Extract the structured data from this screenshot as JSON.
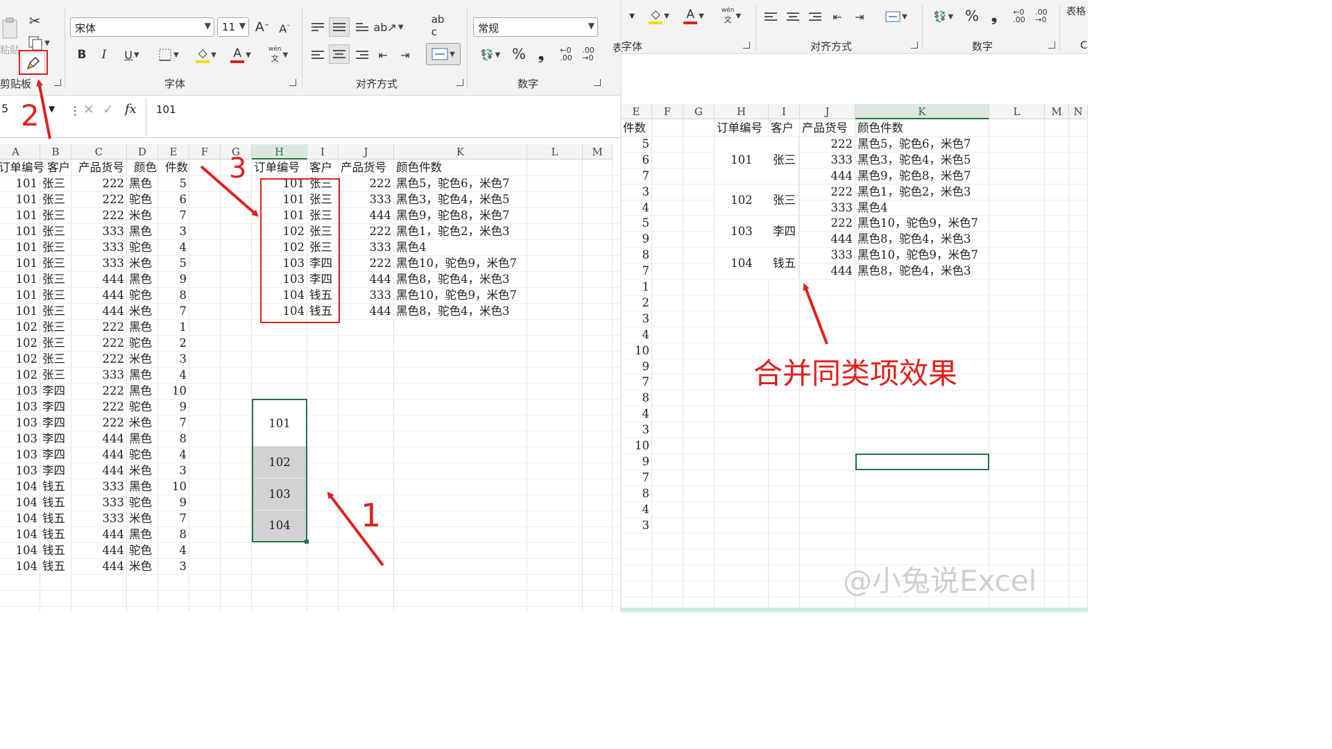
{
  "ribbon": {
    "clipboard_label": "剪贴板",
    "paste_label": "粘贴",
    "font_group_label": "字体",
    "align_group_label": "对齐方式",
    "number_group_label": "数字",
    "font_name": "宋体",
    "font_size": "11",
    "number_format": "常规",
    "bold": "B",
    "italic": "I",
    "underline": "U",
    "percent": "%",
    "comma": "❟",
    "wen": "wén",
    "grow": "A",
    "shrink": "A"
  },
  "ribbon_right": {
    "font_group_partial": "字体",
    "biao_partial": "表",
    "align_group_label": "对齐方式",
    "number_group_label": "数字",
    "table_partial": "表格"
  },
  "formula_bar": {
    "name_box": "5",
    "fx": "fx",
    "value": "101"
  },
  "left_sheet": {
    "columns": [
      "A",
      "B",
      "C",
      "D",
      "E",
      "F",
      "G",
      "H",
      "I",
      "J",
      "K",
      "L",
      "M"
    ],
    "selected_column": "H",
    "headers": [
      "订单编号",
      "客户",
      "产品货号",
      "颜色",
      "件数"
    ],
    "rows": [
      [
        "101",
        "张三",
        "222",
        "黑色",
        "5"
      ],
      [
        "101",
        "张三",
        "222",
        "驼色",
        "6"
      ],
      [
        "101",
        "张三",
        "222",
        "米色",
        "7"
      ],
      [
        "101",
        "张三",
        "333",
        "黑色",
        "3"
      ],
      [
        "101",
        "张三",
        "333",
        "驼色",
        "4"
      ],
      [
        "101",
        "张三",
        "333",
        "米色",
        "5"
      ],
      [
        "101",
        "张三",
        "444",
        "黑色",
        "9"
      ],
      [
        "101",
        "张三",
        "444",
        "驼色",
        "8"
      ],
      [
        "101",
        "张三",
        "444",
        "米色",
        "7"
      ],
      [
        "102",
        "张三",
        "222",
        "黑色",
        "1"
      ],
      [
        "102",
        "张三",
        "222",
        "驼色",
        "2"
      ],
      [
        "102",
        "张三",
        "222",
        "米色",
        "3"
      ],
      [
        "102",
        "张三",
        "333",
        "黑色",
        "4"
      ],
      [
        "103",
        "李四",
        "222",
        "黑色",
        "10"
      ],
      [
        "103",
        "李四",
        "222",
        "驼色",
        "9"
      ],
      [
        "103",
        "李四",
        "222",
        "米色",
        "7"
      ],
      [
        "103",
        "李四",
        "444",
        "黑色",
        "8"
      ],
      [
        "103",
        "李四",
        "444",
        "驼色",
        "4"
      ],
      [
        "103",
        "李四",
        "444",
        "米色",
        "3"
      ],
      [
        "104",
        "钱五",
        "333",
        "黑色",
        "10"
      ],
      [
        "104",
        "钱五",
        "333",
        "驼色",
        "9"
      ],
      [
        "104",
        "钱五",
        "333",
        "米色",
        "7"
      ],
      [
        "104",
        "钱五",
        "444",
        "黑色",
        "8"
      ],
      [
        "104",
        "钱五",
        "444",
        "驼色",
        "4"
      ],
      [
        "104",
        "钱五",
        "444",
        "米色",
        "3"
      ]
    ],
    "summary_headers": [
      "订单编号",
      "客户",
      "产品货号",
      "颜色件数"
    ],
    "summary_rows": [
      [
        "101",
        "张三",
        "222",
        "黑色5，驼色6，米色7"
      ],
      [
        "101",
        "张三",
        "333",
        "黑色3，驼色4，米色5"
      ],
      [
        "101",
        "张三",
        "444",
        "黑色9，驼色8，米色7"
      ],
      [
        "102",
        "张三",
        "222",
        "黑色1，驼色2，米色3"
      ],
      [
        "102",
        "张三",
        "333",
        "黑色4"
      ],
      [
        "103",
        "李四",
        "222",
        "黑色10，驼色9，米色7"
      ],
      [
        "103",
        "李四",
        "444",
        "黑色8，驼色4，米色3"
      ],
      [
        "104",
        "钱五",
        "333",
        "黑色10，驼色9，米色7"
      ],
      [
        "104",
        "钱五",
        "444",
        "黑色8，驼色4，米色3"
      ]
    ],
    "merged_cells": [
      "101",
      "102",
      "103",
      "104"
    ]
  },
  "right_sheet": {
    "columns": [
      "E",
      "F",
      "G",
      "H",
      "I",
      "J",
      "K",
      "L",
      "M",
      "N"
    ],
    "selected_column": "K",
    "headers": [
      "件数",
      "订单编号",
      "客户",
      "产品货号",
      "颜色件数"
    ],
    "e_values": [
      "5",
      "6",
      "7",
      "3",
      "4",
      "5",
      "9",
      "8",
      "7",
      "1",
      "2",
      "3",
      "4",
      "10",
      "9",
      "7",
      "8",
      "4",
      "3",
      "10",
      "9",
      "7",
      "8",
      "4",
      "3"
    ],
    "groups": [
      {
        "order": "101",
        "customer": "张三"
      },
      {
        "order": "102",
        "customer": "张三"
      },
      {
        "order": "103",
        "customer": "李四"
      },
      {
        "order": "104",
        "customer": "钱五"
      }
    ],
    "detail_rows": [
      [
        "222",
        "黑色5，驼色6，米色7"
      ],
      [
        "333",
        "黑色3，驼色4，米色5"
      ],
      [
        "444",
        "黑色9，驼色8，米色7"
      ],
      [
        "222",
        "黑色1，驼色2，米色3"
      ],
      [
        "333",
        "黑色4"
      ],
      [
        "222",
        "黑色10，驼色9，米色7"
      ],
      [
        "444",
        "黑色8，驼色4，米色3"
      ],
      [
        "333",
        "黑色10，驼色9，米色7"
      ],
      [
        "444",
        "黑色8，驼色4，米色3"
      ]
    ]
  },
  "annotations": {
    "step1": "1",
    "step2": "2",
    "step3": "3",
    "caption": "合并同类项效果",
    "watermark": "@小兔说Excel",
    "accent_color": "#e0201c"
  }
}
